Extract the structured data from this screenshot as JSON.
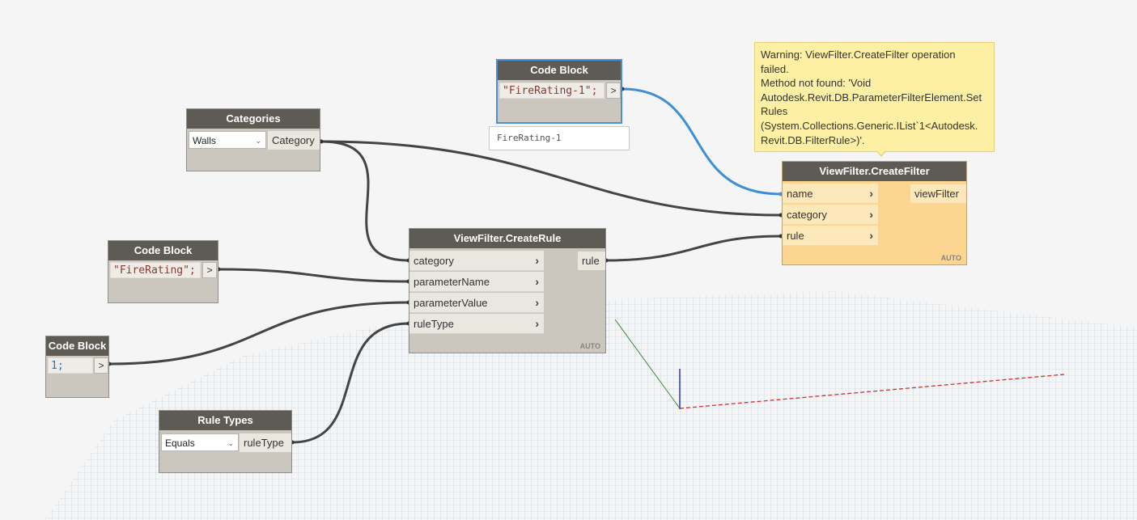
{
  "colors": {
    "wire": "#444444",
    "wire_selected": "#3a8fd8",
    "node_header": "#5e5b55",
    "node_body": "#cbc6be",
    "warning_node": "#fcd691",
    "tooltip": "#fdf0a4",
    "grid": "#b5cbd8"
  },
  "nodes": {
    "code_block_top": {
      "title": "Code Block",
      "code": "\"FireRating-1\";",
      "out_label": ">",
      "preview": "FireRating-1"
    },
    "categories": {
      "title": "Categories",
      "selected": "Walls",
      "output": "Category"
    },
    "code_block_mid": {
      "title": "Code Block",
      "code": "\"FireRating\";",
      "out_label": ">"
    },
    "code_block_low": {
      "title": "Code Block",
      "code": "1;",
      "out_label": ">"
    },
    "rule_types": {
      "title": "Rule Types",
      "selected": "Equals",
      "output": "ruleType"
    },
    "create_rule": {
      "title": "ViewFilter.CreateRule",
      "inputs": [
        "category",
        "parameterName",
        "parameterValue",
        "ruleType"
      ],
      "output": "rule",
      "lacing": "AUTO"
    },
    "create_filter": {
      "title": "ViewFilter.CreateFilter",
      "inputs": [
        "name",
        "category",
        "rule"
      ],
      "output": "viewFilter",
      "lacing": "AUTO"
    }
  },
  "warning": {
    "lines": [
      "Warning: ViewFilter.CreateFilter operation",
      "failed.",
      "Method not found: 'Void",
      "Autodesk.Revit.DB.ParameterFilterElement.Set",
      "Rules",
      "(System.Collections.Generic.IList`1<Autodesk.",
      "Revit.DB.FilterRule>)'."
    ]
  }
}
